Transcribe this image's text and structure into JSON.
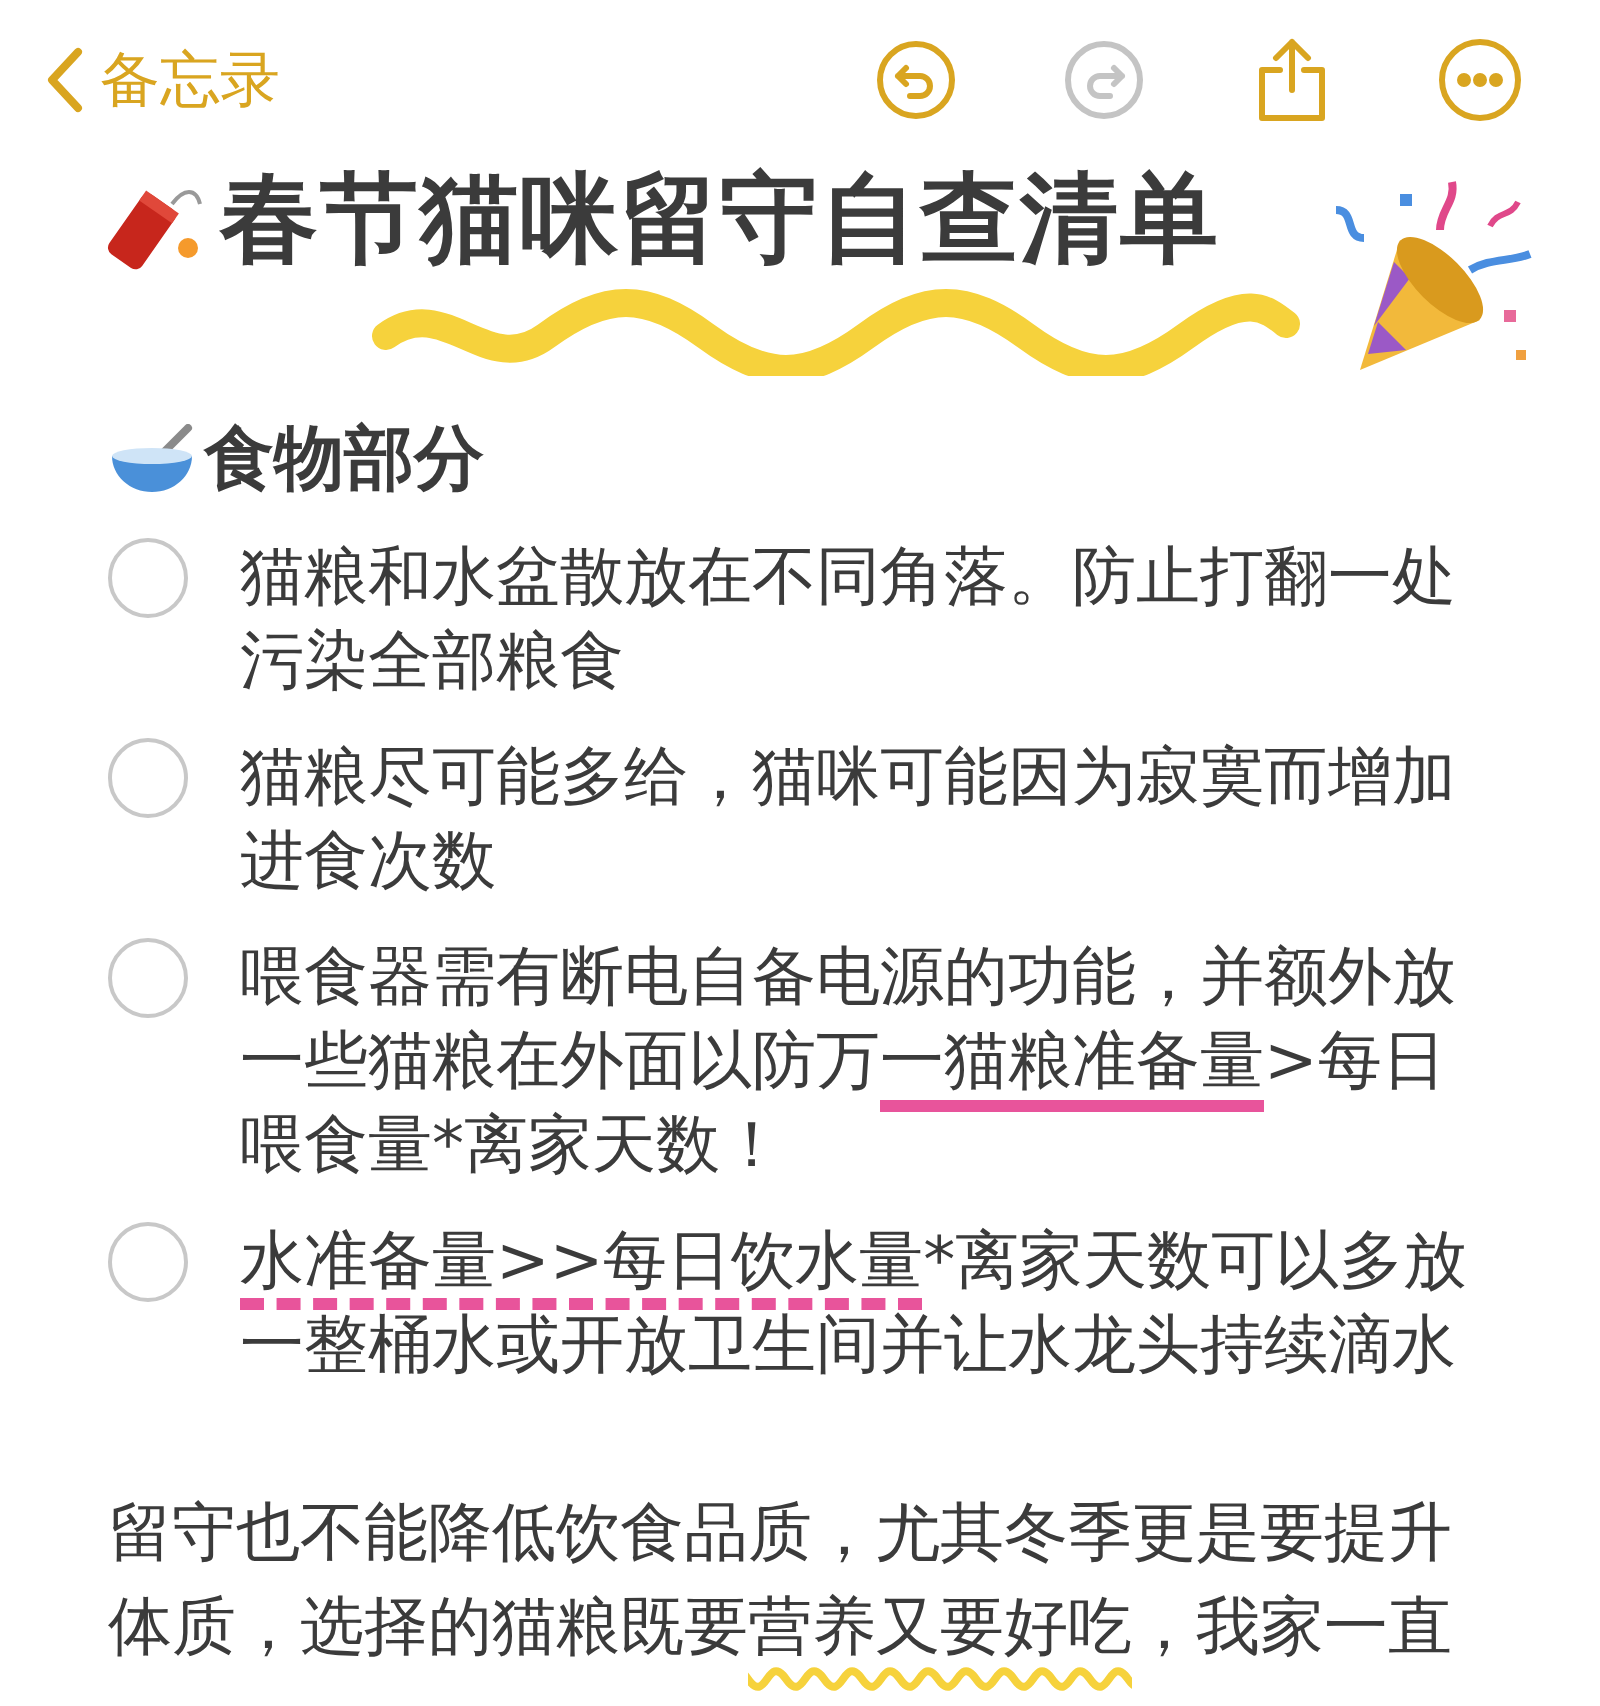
{
  "nav": {
    "back_label": "备忘录",
    "buttons": [
      {
        "kind": "undo",
        "disabled": false
      },
      {
        "kind": "redo",
        "disabled": true
      },
      {
        "kind": "share",
        "disabled": false
      },
      {
        "kind": "more",
        "disabled": false
      }
    ]
  },
  "title": "春节猫咪留守自查清单",
  "section": {
    "heading": "食物部分"
  },
  "checklist": [
    {
      "checked": false,
      "segments": [
        {
          "kind": "plain",
          "text": "猫粮和水盆散放在不同角落。防止打翻一处污染全部粮食"
        }
      ]
    },
    {
      "checked": false,
      "segments": [
        {
          "kind": "plain",
          "text": "猫粮尽可能多给，猫咪可能因为寂寞而增加进食次数"
        }
      ]
    },
    {
      "checked": false,
      "segments": [
        {
          "kind": "plain",
          "text": "喂食器需有断电自备电源的功能，并额外放一些猫粮在外面以防万"
        },
        {
          "kind": "underline",
          "text": "一猫粮准备量"
        },
        {
          "kind": "plain",
          "text": ">每日喂食量*离家天数！"
        }
      ]
    },
    {
      "checked": false,
      "segments": [
        {
          "kind": "dashed",
          "text": "水准备量>>每日饮水量"
        },
        {
          "kind": "plain",
          "text": "*离家天数可以多放一整桶水或开放卫生间并让水龙头持续滴水"
        }
      ]
    }
  ],
  "paragraph": {
    "segments": [
      {
        "kind": "plain",
        "text": "留守也不能降低饮食品质，尤其冬季更是要提升体质，选择的猫粮既要"
      },
      {
        "kind": "wavy",
        "text": "营养又要好吃"
      },
      {
        "kind": "plain",
        "text": "，我家一直"
      }
    ]
  }
}
